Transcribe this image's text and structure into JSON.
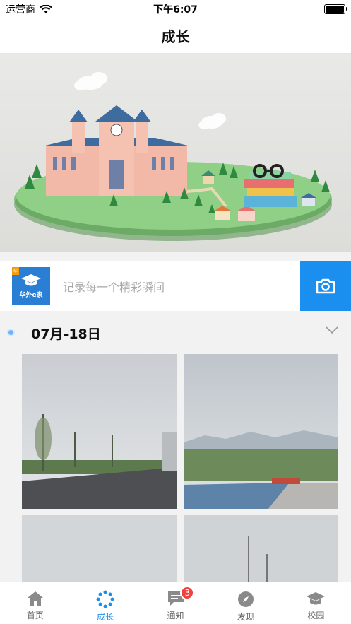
{
  "status_bar": {
    "carrier": "运营商",
    "time": "下午6:07"
  },
  "nav": {
    "title": "成长"
  },
  "record": {
    "logo_tag": "华外e家",
    "logo_name": "华外e家",
    "placeholder": "记录每一个精彩瞬间"
  },
  "timeline": {
    "date": "07月-18日"
  },
  "tabs": [
    {
      "label": "首页",
      "icon": "home-icon"
    },
    {
      "label": "成长",
      "icon": "growth-icon"
    },
    {
      "label": "通知",
      "icon": "message-icon",
      "badge": "3"
    },
    {
      "label": "发现",
      "icon": "compass-icon"
    },
    {
      "label": "校园",
      "icon": "graduation-cap-icon"
    }
  ],
  "colors": {
    "accent": "#1b8ff0",
    "badge": "#f0413c"
  }
}
